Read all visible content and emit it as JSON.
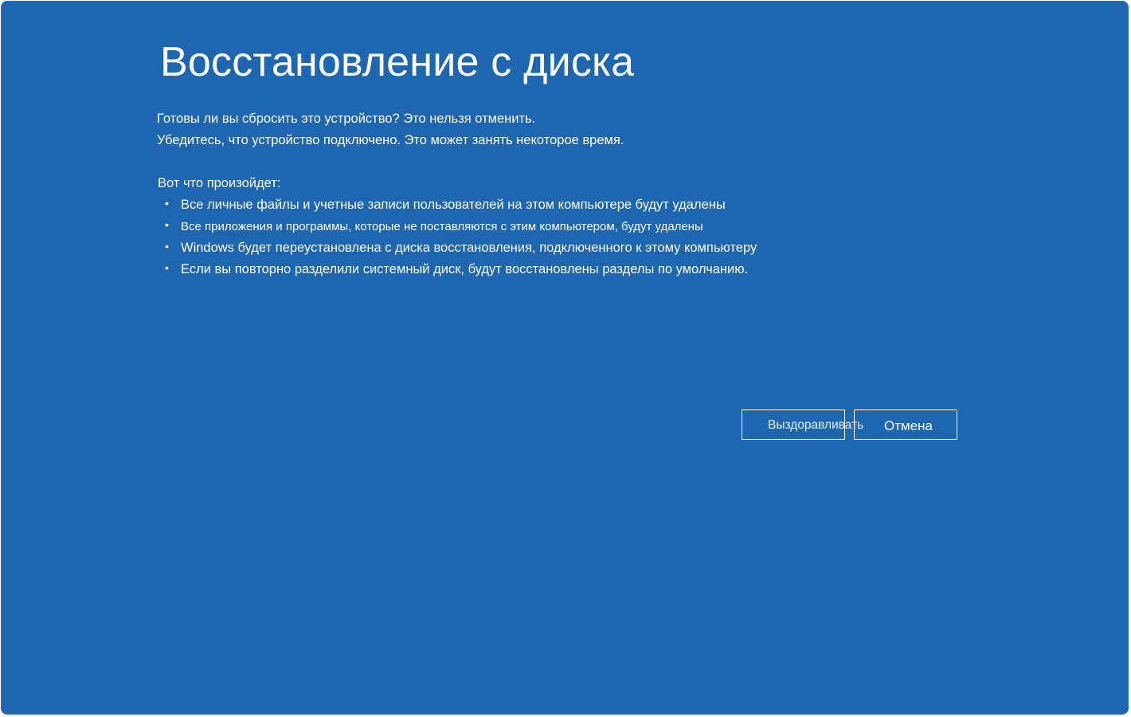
{
  "page": {
    "title": "Восстановление с диска",
    "intro_lines": [
      "Готовы ли вы сбросить это устройство? Это нельзя отменить.",
      "Убедитесь, что устройство подключено. Это может занять некоторое время."
    ],
    "happens_label": "Вот что произойдет:",
    "bullets": [
      "Все личные файлы и учетные записи пользователей на этом компьютере будут удалены",
      "Все приложения и программы, которые не поставляются с этим компьютером, будут удалены",
      "Windows будет переустановлена с диска восстановления, подключенного к этому компьютеру",
      "Если вы повторно разделили системный диск, будут восстановлены разделы по умолчанию."
    ],
    "bullet_glyph": "•"
  },
  "buttons": {
    "recover_label": "Выздоравливать",
    "cancel_label": "Отмена"
  },
  "colors": {
    "background": "#1f66b1",
    "text": "#ffffff"
  }
}
